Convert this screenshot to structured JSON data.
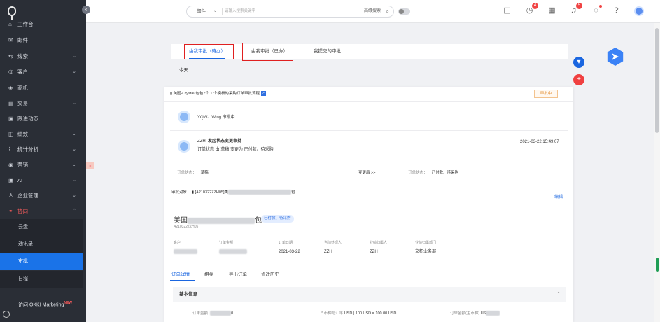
{
  "sidebar": {
    "items": [
      {
        "label": "工作台",
        "icon": "home-icon",
        "glyph": "⌂"
      },
      {
        "label": "邮件",
        "icon": "mail-icon",
        "glyph": "✉"
      },
      {
        "label": "线索",
        "icon": "lead-icon",
        "glyph": "⇆"
      },
      {
        "label": "客户",
        "icon": "customer-icon",
        "glyph": "◎"
      },
      {
        "label": "商机",
        "icon": "opportunity-icon",
        "glyph": "◈"
      },
      {
        "label": "交易",
        "icon": "transaction-icon",
        "glyph": "▤"
      },
      {
        "label": "跟进动态",
        "icon": "follow-up-icon",
        "glyph": "▣"
      },
      {
        "label": "绩效",
        "icon": "performance-icon",
        "glyph": "◫"
      },
      {
        "label": "统计分析",
        "icon": "stats-icon",
        "glyph": "⌇"
      },
      {
        "label": "营销",
        "icon": "marketing-icon",
        "glyph": "◉"
      },
      {
        "label": "AI",
        "icon": "ai-icon",
        "glyph": "▣"
      },
      {
        "label": "企业管理",
        "icon": "enterprise-icon",
        "glyph": "♙"
      },
      {
        "label": "协同",
        "icon": "collab-icon",
        "glyph": "⚭"
      }
    ],
    "sub_items": [
      "云盘",
      "通讯录",
      "审批",
      "日程"
    ],
    "okki": {
      "label": "访问 OKKI Marketing",
      "new": "NEW"
    }
  },
  "topbar": {
    "search_type": "邮件",
    "search_placeholder": "请输入搜索关键字",
    "advanced": "高级搜索",
    "badge_clock": "4",
    "badge_bell": "5"
  },
  "tabs": [
    "由我审批（待办）",
    "由我审批（已办）",
    "我提交的审批"
  ],
  "today": "今天",
  "card": {
    "title": "美国-Crystal-包包7个 1 个模板的采购订单审批流程",
    "status": "审批中",
    "approvers": "YQW、Wing 审批中",
    "initiator": "ZZH",
    "action": "发起状态变更审批",
    "change_desc": "订单状态 由 草稿 变更为 已付款、待采购",
    "timestamp": "2021-03-22 15:49:07",
    "order_status_label": "订单状态：",
    "order_status_from": "草稿",
    "changed_after": "变更后 >>",
    "order_status_label2": "订单状态：",
    "order_status_to": "已付款、待采购",
    "approval_target_label": "审批对象：",
    "approval_target": "[A210322ZZH05]美",
    "approval_target_tail": "包",
    "edit_link": "编辑",
    "product_prefix": "美国",
    "product_tail": "包",
    "product_tag": "已付款、待采购",
    "order_no": "A210322ZZH05",
    "fields": [
      {
        "label": "客户",
        "value": ""
      },
      {
        "label": "订单金额",
        "value": ""
      },
      {
        "label": "订单日期",
        "value": "2021-03-22"
      },
      {
        "label": "当前处理人",
        "value": "ZZH"
      },
      {
        "label": "业绩归属人",
        "value": "ZZH"
      },
      {
        "label": "业绩归属部门",
        "value": "文积业务部"
      }
    ],
    "sub_tabs": [
      "订单详情",
      "相关",
      "导出订单",
      "修改历史"
    ],
    "basic_info": "基本信息",
    "bottom": {
      "amount_label": "订单金额",
      "amount_tail": "0",
      "rate_label": "* 币种与汇率",
      "rate_value": "USD | 100 USD = 100.00 USD",
      "amount_main_label": "订单金额(主币种)",
      "amount_main_value": "US"
    }
  }
}
